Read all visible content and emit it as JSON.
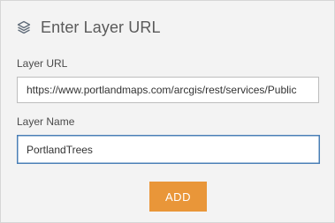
{
  "dialog": {
    "title": "Enter Layer URL",
    "header_icon": "layers-icon"
  },
  "url_field": {
    "label": "Layer URL",
    "value": "https://www.portlandmaps.com/arcgis/rest/services/Public"
  },
  "name_field": {
    "label": "Layer Name",
    "value": "PortlandTrees"
  },
  "add_button": {
    "label": "ADD"
  },
  "colors": {
    "accent": "#e99639",
    "focus_border": "#4a7fb6",
    "panel_background": "#f3f3f3"
  }
}
